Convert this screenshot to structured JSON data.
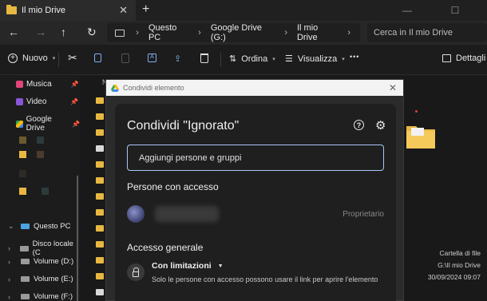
{
  "tab": {
    "title": "Il mio Drive"
  },
  "address": {
    "crumbs": [
      "Questo PC",
      "Google Drive (G:)",
      "Il mio Drive"
    ],
    "search_placeholder": "Cerca in Il mio Drive"
  },
  "toolbar": {
    "new_label": "Nuovo",
    "sort_label": "Ordina",
    "view_label": "Visualizza",
    "more_label": "•••",
    "details_label": "Dettagli"
  },
  "sidebar": {
    "quick": [
      {
        "label": "Musica",
        "color": "#e0457b"
      },
      {
        "label": "Video",
        "color": "#8a55d8"
      },
      {
        "label": "Google Drive",
        "color": "#4285f4"
      }
    ],
    "tree": [
      {
        "label": "Questo PC",
        "chev": "⌄"
      },
      {
        "label": "Disco locale (C",
        "chev": "›"
      },
      {
        "label": "Volume (D:)",
        "chev": "›"
      },
      {
        "label": "Volume (E:)",
        "chev": "›"
      },
      {
        "label": "Volume (F:)",
        "chev": "›"
      }
    ]
  },
  "files": {
    "column_head": "N"
  },
  "details": {
    "type": "Cartella di file",
    "path": "G:\\Il mio Drive",
    "date": "30/09/2024 09:07"
  },
  "dialog": {
    "window_title": "Condividi elemento",
    "title": "Condividi \"Ignorato\"",
    "input_placeholder": "Aggiungi persone e gruppi",
    "people_header": "Persone con accesso",
    "owner_label": "Proprietario",
    "general_header": "Accesso generale",
    "restriction_label": "Con limitazioni",
    "restriction_desc": "Solo le persone con accesso possono usare il link per aprire l'elemento"
  },
  "colors": {
    "accent_border": "#a8c7fa",
    "folder": "#e8b742",
    "dialog_bg": "#1f1f1f"
  }
}
